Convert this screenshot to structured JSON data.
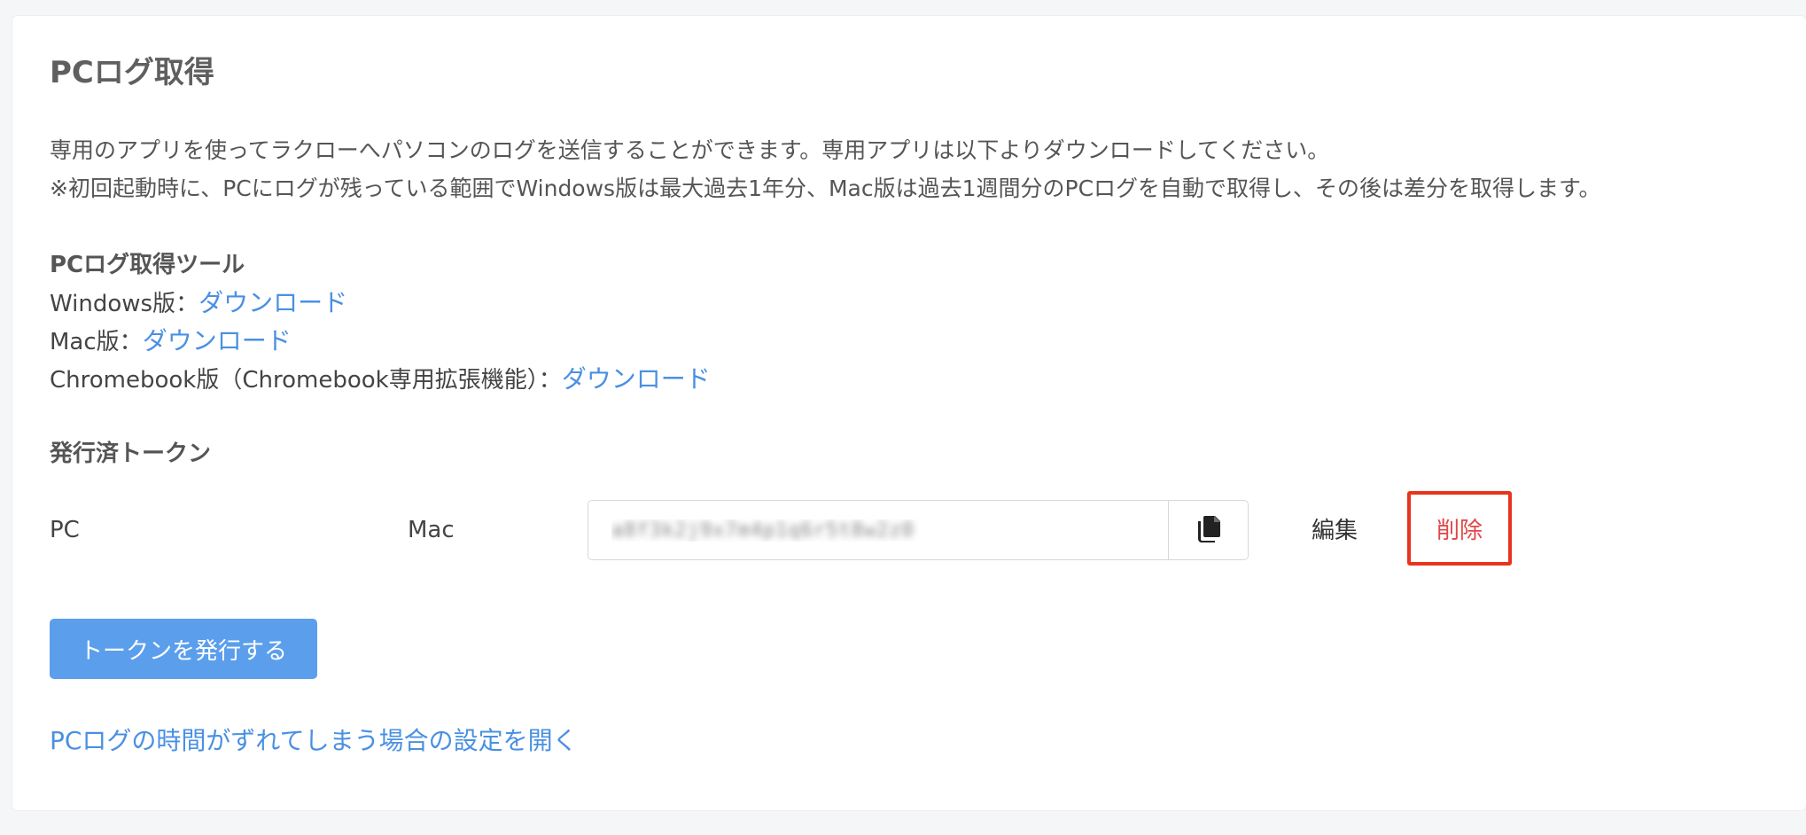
{
  "page": {
    "title": "PCログ取得",
    "description_line1": "専用のアプリを使ってラクローへパソコンのログを送信することができます。専用アプリは以下よりダウンロードしてください。",
    "description_line2": "※初回起動時に、PCにログが残っている範囲でWindows版は最大過去1年分、Mac版は過去1週間分のPCログを自動で取得し、その後は差分を取得します。"
  },
  "tools": {
    "heading": "PCログ取得ツール",
    "separator": "：",
    "items": [
      {
        "label": "Windows版",
        "link": "ダウンロード"
      },
      {
        "label": "Mac版",
        "link": "ダウンロード"
      },
      {
        "label": "Chromebook版（Chromebook専用拡張機能）",
        "link": "ダウンロード"
      }
    ]
  },
  "tokens": {
    "heading": "発行済トークン",
    "rows": [
      {
        "type": "PC",
        "os": "Mac",
        "token": "a8f3k2j9x7m4p1q6r5t8w2z0",
        "edit_label": "編集",
        "delete_label": "削除"
      }
    ]
  },
  "actions": {
    "issue_token_label": "トークンを発行する",
    "time_settings_link": "PCログの時間がずれてしまう場合の設定を開く"
  },
  "colors": {
    "link": "#4a90e2",
    "primary_button": "#5b9eec",
    "delete_text": "#e0474a",
    "highlight_border": "#e8341c"
  },
  "icons": {
    "copy": "copy-icon"
  }
}
